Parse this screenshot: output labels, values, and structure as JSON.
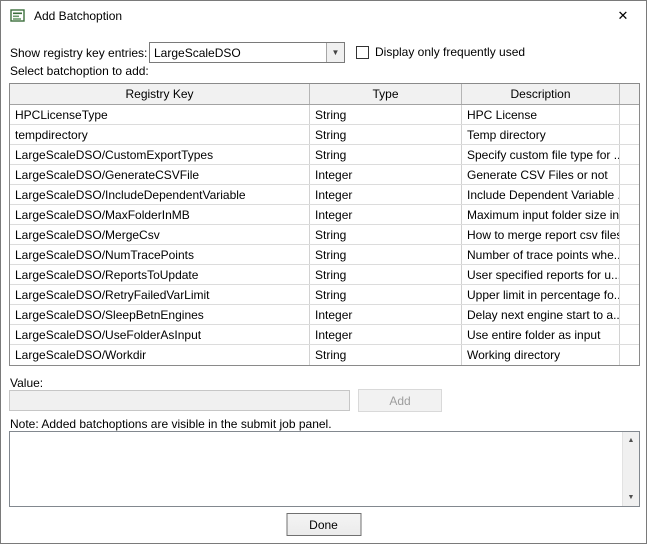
{
  "window": {
    "title": "Add Batchoption",
    "close_glyph": "✕"
  },
  "controls": {
    "registry_label": "Show registry key entries:",
    "registry_selected": "LargeScaleDSO",
    "combo_arrow": "▼",
    "frequent_label": "Display only frequently used",
    "select_label": "Select batchoption to add:",
    "value_label": "Value:",
    "value_input": "",
    "add_label": "Add",
    "note_label": "Note: Added batchoptions are visible in the submit job panel.",
    "done_label": "Done",
    "scroll_up_glyph": "▲",
    "scroll_down_glyph": "▼"
  },
  "table": {
    "headers": [
      "Registry Key",
      "Type",
      "Description"
    ],
    "rows": [
      {
        "key": "HPCLicenseType",
        "type": "String",
        "description": "HPC License"
      },
      {
        "key": "tempdirectory",
        "type": "String",
        "description": "Temp directory"
      },
      {
        "key": "LargeScaleDSO/CustomExportTypes",
        "type": "String",
        "description": "Specify custom file type for ..."
      },
      {
        "key": "LargeScaleDSO/GenerateCSVFile",
        "type": "Integer",
        "description": "Generate CSV Files or not"
      },
      {
        "key": "LargeScaleDSO/IncludeDependentVariable",
        "type": "Integer",
        "description": "Include Dependent Variable ..."
      },
      {
        "key": "LargeScaleDSO/MaxFolderInMB",
        "type": "Integer",
        "description": "Maximum input folder size in..."
      },
      {
        "key": "LargeScaleDSO/MergeCsv",
        "type": "String",
        "description": "How to merge report csv files"
      },
      {
        "key": "LargeScaleDSO/NumTracePoints",
        "type": "String",
        "description": "Number of trace points whe..."
      },
      {
        "key": "LargeScaleDSO/ReportsToUpdate",
        "type": "String",
        "description": "User specified reports for u..."
      },
      {
        "key": "LargeScaleDSO/RetryFailedVarLimit",
        "type": "String",
        "description": "Upper limit in percentage fo..."
      },
      {
        "key": "LargeScaleDSO/SleepBetnEngines",
        "type": "Integer",
        "description": "Delay next engine start to a..."
      },
      {
        "key": "LargeScaleDSO/UseFolderAsInput",
        "type": "Integer",
        "description": "Use entire folder as input"
      },
      {
        "key": "LargeScaleDSO/Workdir",
        "type": "String",
        "description": "Working directory"
      }
    ]
  }
}
